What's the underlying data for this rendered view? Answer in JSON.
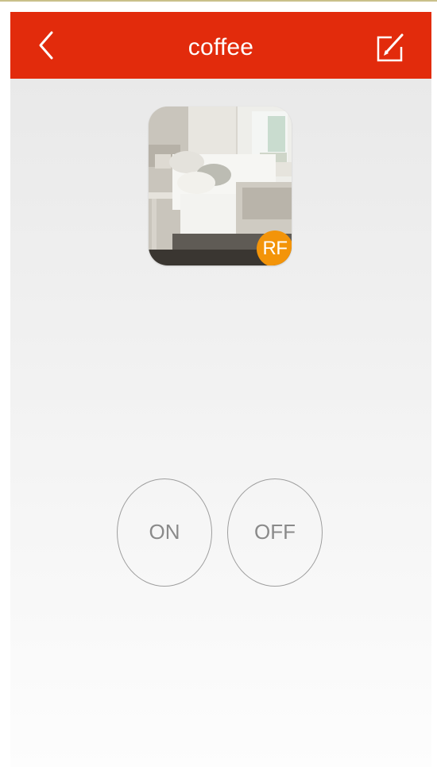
{
  "header": {
    "title": "coffee",
    "back_icon": "chevron-left-icon",
    "edit_icon": "edit-icon"
  },
  "device": {
    "image": "bedroom-photo",
    "badge": "RF"
  },
  "controls": {
    "on_label": "ON",
    "off_label": "OFF"
  },
  "colors": {
    "appbar": "#e22b0c",
    "badge": "#f39409",
    "button_border": "#9e9e9e",
    "button_text": "#8a8a8a"
  }
}
